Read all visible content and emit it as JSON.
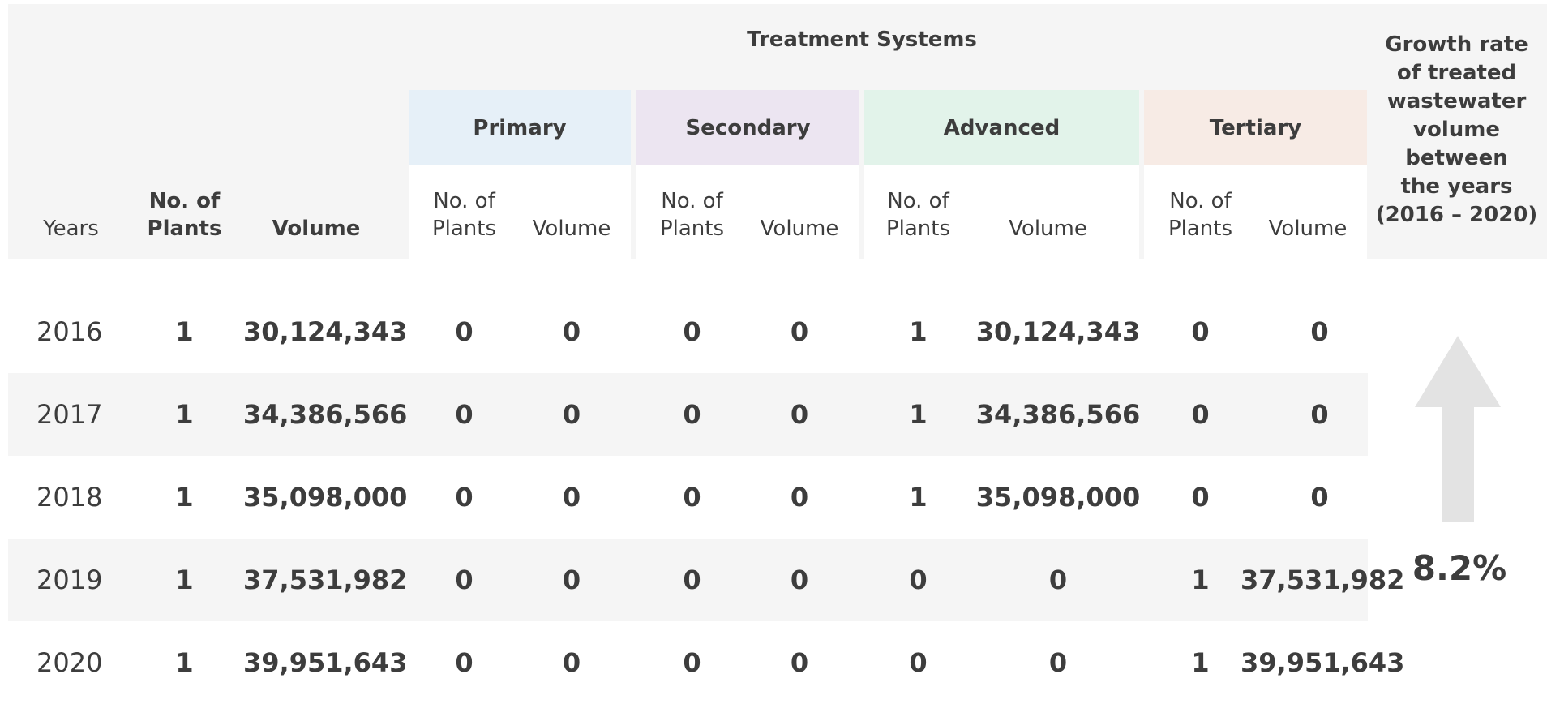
{
  "header": {
    "treatment_systems_title": "Treatment Systems",
    "years_label": "Years",
    "no_of": "No. of",
    "plants": "Plants",
    "volume": "Volume",
    "systems": {
      "primary": "Primary",
      "secondary": "Secondary",
      "advanced": "Advanced",
      "tertiary": "Tertiary"
    },
    "growth_rate_lines": [
      "Growth rate",
      "of treated",
      "wastewater",
      "volume",
      "between",
      "the years",
      "(2016 – 2020)"
    ]
  },
  "colors": {
    "primary_band": "#e6f0f8",
    "secondary_band": "#ece5f1",
    "advanced_band": "#e2f3ea",
    "tertiary_band": "#f7ebe5",
    "stripe": "#f5f5f5",
    "arrow": "#e3e3e3"
  },
  "rows": [
    {
      "year": "2016",
      "plants": "1",
      "volume": "30,124,343",
      "primary_plants": "0",
      "primary_volume": "0",
      "secondary_plants": "0",
      "secondary_volume": "0",
      "advanced_plants": "1",
      "advanced_volume": "30,124,343",
      "tertiary_plants": "0",
      "tertiary_volume": "0"
    },
    {
      "year": "2017",
      "plants": "1",
      "volume": "34,386,566",
      "primary_plants": "0",
      "primary_volume": "0",
      "secondary_plants": "0",
      "secondary_volume": "0",
      "advanced_plants": "1",
      "advanced_volume": "34,386,566",
      "tertiary_plants": "0",
      "tertiary_volume": "0"
    },
    {
      "year": "2018",
      "plants": "1",
      "volume": "35,098,000",
      "primary_plants": "0",
      "primary_volume": "0",
      "secondary_plants": "0",
      "secondary_volume": "0",
      "advanced_plants": "1",
      "advanced_volume": "35,098,000",
      "tertiary_plants": "0",
      "tertiary_volume": "0"
    },
    {
      "year": "2019",
      "plants": "1",
      "volume": "37,531,982",
      "primary_plants": "0",
      "primary_volume": "0",
      "secondary_plants": "0",
      "secondary_volume": "0",
      "advanced_plants": "0",
      "advanced_volume": "0",
      "tertiary_plants": "1",
      "tertiary_volume": "37,531,982"
    },
    {
      "year": "2020",
      "plants": "1",
      "volume": "39,951,643",
      "primary_plants": "0",
      "primary_volume": "0",
      "secondary_plants": "0",
      "secondary_volume": "0",
      "advanced_plants": "0",
      "advanced_volume": "0",
      "tertiary_plants": "1",
      "tertiary_volume": "39,951,643"
    }
  ],
  "growth": {
    "value": "8.2%",
    "arrow_icon": "up-arrow-icon"
  }
}
